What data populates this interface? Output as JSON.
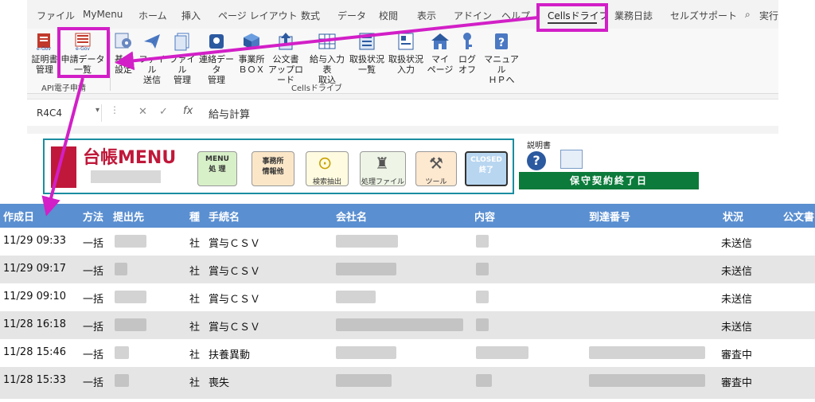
{
  "ribbon_tabs": [
    "ファイル",
    "MyMenu",
    "ホーム",
    "挿入",
    "ページ レイアウト",
    "数式",
    "データ",
    "校閲",
    "表示",
    "アドイン",
    "ヘルプ",
    "Cellsドライブ",
    "業務日誌",
    "セルズサポート",
    "実行"
  ],
  "ribbon_buttons": [
    {
      "label": "証明書\n管理"
    },
    {
      "label": "申請データ\n一覧"
    },
    {
      "label": "基本\n設定"
    },
    {
      "label": "ファイル\n送信"
    },
    {
      "label": "ファイル\n管理"
    },
    {
      "label": "連絡データ\n管理"
    },
    {
      "label": "事業所\nＢＯＸ"
    },
    {
      "label": "公文書\nアップロード"
    },
    {
      "label": "給与入力表\n取込"
    },
    {
      "label": "取扱状況\n一覧"
    },
    {
      "label": "取扱状況\n入力"
    },
    {
      "label": "マイ\nページ"
    },
    {
      "label": "ログ\nオフ"
    },
    {
      "label": "マニュアル\nＨＰへ"
    }
  ],
  "groups": {
    "api": "API電子申請",
    "cells": "Cellsドライブ"
  },
  "formula_bar": {
    "name_box": "R4C4",
    "fx": "fx",
    "content": "給与計算"
  },
  "sheet_menu": {
    "title": "台帳MENU",
    "buttons": [
      {
        "label": "MENU\n処 理"
      },
      {
        "label": "事務所\n情報他"
      },
      {
        "label": "検索抽出"
      },
      {
        "label": "処理ファイル"
      },
      {
        "label": "ツール"
      },
      {
        "label": "CLOSED\n終了"
      }
    ],
    "manual_label": "説明書",
    "maintenance_label": "保守契約終了日"
  },
  "table": {
    "headers": [
      "作成日",
      "方法",
      "提出先",
      "種",
      "手続名",
      "会社名",
      "内容",
      "到達番号",
      "状況",
      "公文書"
    ],
    "rows": [
      {
        "date": "11/29 09:33",
        "method": "一括",
        "type": "社",
        "proc": "賞与ＣＳＶ",
        "status": "未送信"
      },
      {
        "date": "11/29 09:17",
        "method": "一括",
        "type": "社",
        "proc": "賞与ＣＳＶ",
        "status": "未送信"
      },
      {
        "date": "11/29 09:10",
        "method": "一括",
        "type": "社",
        "proc": "賞与ＣＳＶ",
        "status": "未送信"
      },
      {
        "date": "11/28 16:18",
        "method": "一括",
        "type": "社",
        "proc": "賞与ＣＳＶ",
        "status": "未送信"
      },
      {
        "date": "11/28 15:46",
        "method": "一括",
        "type": "社",
        "proc": "扶養異動",
        "status": "審査中"
      },
      {
        "date": "11/28 15:33",
        "method": "一括",
        "type": "社",
        "proc": "喪失",
        "status": "審査中"
      }
    ]
  },
  "colors": {
    "header_blue": "#5a8fd1",
    "highlight": "#d21fc7",
    "teal": "#1a8da0",
    "green_bar": "#0b7a3a"
  }
}
